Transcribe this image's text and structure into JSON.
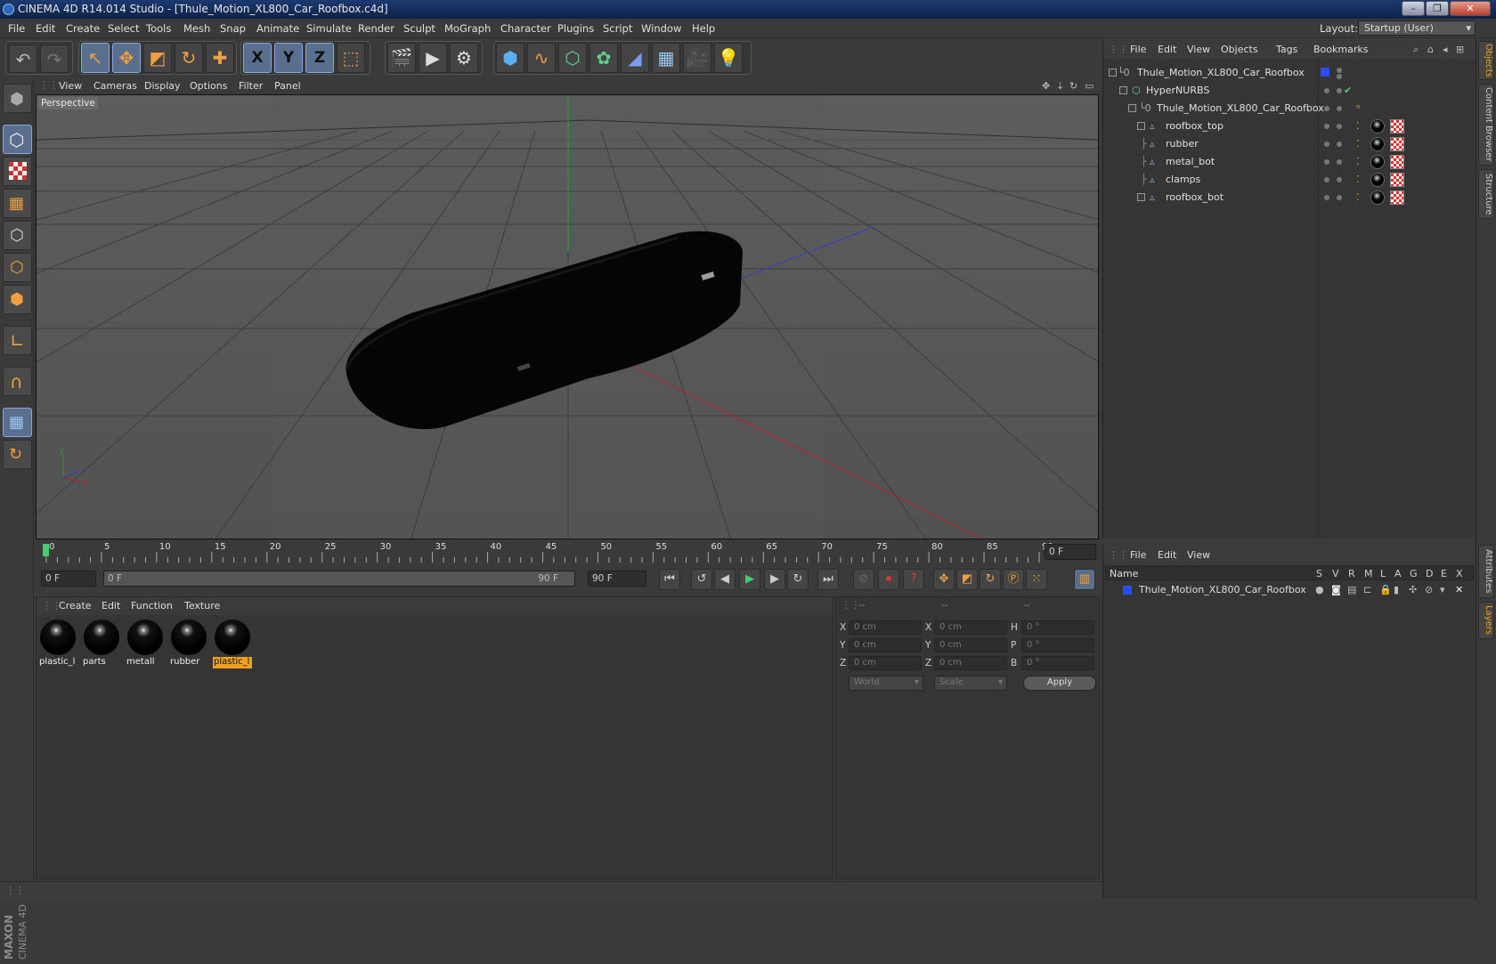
{
  "titlebar": {
    "title": "CINEMA 4D R14.014 Studio - [Thule_Motion_XL800_Car_Roofbox.c4d]"
  },
  "menu": [
    "File",
    "Edit",
    "Create",
    "Select",
    "Tools",
    "Mesh",
    "Snap",
    "Animate",
    "Simulate",
    "Render",
    "Sculpt",
    "MoGraph",
    "Character",
    "Plugins",
    "Script",
    "Window",
    "Help"
  ],
  "layout": {
    "label": "Layout:",
    "value": "Startup (User)"
  },
  "toolbar": {
    "icons": [
      "undo-icon",
      "redo-icon",
      "live-selection-icon",
      "move-icon",
      "scale-icon",
      "rotate-icon",
      "add-icon",
      "x-axis-icon",
      "y-axis-icon",
      "z-axis-icon",
      "coordinate-system-icon",
      "render-view-icon",
      "render-picture-viewer-icon",
      "edit-render-settings-icon",
      "cube-icon",
      "spline-pen-icon",
      "subdivision-icon",
      "array-icon",
      "deformer-icon",
      "floor-icon",
      "camera-icon",
      "light-icon"
    ],
    "axis": [
      "X",
      "Y",
      "Z"
    ]
  },
  "viewport": {
    "menu": [
      "View",
      "Cameras",
      "Display",
      "Options",
      "Filter",
      "Panel"
    ],
    "label": "Perspective",
    "accent": "#f0a020"
  },
  "timeline": {
    "ticks": [
      "0",
      "5",
      "10",
      "15",
      "20",
      "25",
      "30",
      "35",
      "40",
      "45",
      "50",
      "55",
      "60",
      "65",
      "70",
      "75",
      "80",
      "85",
      "90"
    ],
    "current_frame": "0 F"
  },
  "transport": {
    "start": "0 F",
    "range_start": "0 F",
    "range_end": "90 F",
    "end": "90 F"
  },
  "materials": {
    "menu": [
      "Create",
      "Edit",
      "Function",
      "Texture"
    ],
    "items": [
      {
        "label": "plastic_l"
      },
      {
        "label": "parts"
      },
      {
        "label": "metall"
      },
      {
        "label": "rubber"
      },
      {
        "label": "plastic_l"
      }
    ]
  },
  "coords": {
    "headers": [
      "--",
      "--",
      "--"
    ],
    "rows": [
      {
        "a": "X",
        "v1": "0 cm",
        "b": "X",
        "v2": "0 cm",
        "c": "H",
        "v3": "0 °"
      },
      {
        "a": "Y",
        "v1": "0 cm",
        "b": "Y",
        "v2": "0 cm",
        "c": "P",
        "v3": "0 °"
      },
      {
        "a": "Z",
        "v1": "0 cm",
        "b": "Z",
        "v2": "0 cm",
        "c": "B",
        "v3": "0 °"
      }
    ],
    "world": "World",
    "scale": "Scale",
    "apply": "Apply"
  },
  "objects": {
    "menu": [
      "File",
      "Edit",
      "View",
      "Objects",
      "Tags",
      "Bookmarks"
    ],
    "items": [
      {
        "name": "Thule_Motion_XL800_Car_Roofbox"
      },
      {
        "name": "HyperNURBS"
      },
      {
        "name": "Thule_Motion_XL800_Car_Roofbox"
      },
      {
        "name": "roofbox_top"
      },
      {
        "name": "rubber"
      },
      {
        "name": "metal_bot"
      },
      {
        "name": "clamps"
      },
      {
        "name": "roofbox_bot"
      }
    ]
  },
  "layers": {
    "menu": [
      "File",
      "Edit",
      "View"
    ],
    "header_name": "Name",
    "columns": [
      "S",
      "V",
      "R",
      "M",
      "L",
      "A",
      "G",
      "D",
      "E",
      "X"
    ],
    "items": [
      {
        "name": "Thule_Motion_XL800_Car_Roofbox",
        "color": "#2a4cff"
      }
    ]
  },
  "sidetabs": [
    "Objects",
    "Content Browser",
    "Structure",
    "Attributes",
    "Layers"
  ],
  "brand": {
    "line1": "MAXON",
    "line2": "CINEMA 4D"
  }
}
